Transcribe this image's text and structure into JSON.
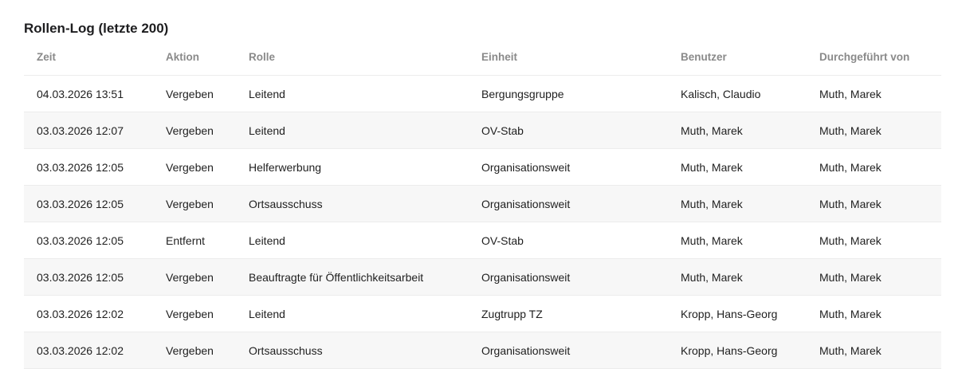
{
  "section": {
    "title": "Rollen-Log (letzte 200)"
  },
  "table": {
    "headers": [
      "Zeit",
      "Aktion",
      "Rolle",
      "Einheit",
      "Benutzer",
      "Durchgeführt von"
    ],
    "rows": [
      [
        "04.03.2026 13:51",
        "Vergeben",
        "Leitend",
        "Bergungsgruppe",
        "Kalisch, Claudio",
        "Muth, Marek"
      ],
      [
        "03.03.2026 12:07",
        "Vergeben",
        "Leitend",
        "OV-Stab",
        "Muth, Marek",
        "Muth, Marek"
      ],
      [
        "03.03.2026 12:05",
        "Vergeben",
        "Helferwerbung",
        "Organisationsweit",
        "Muth, Marek",
        "Muth, Marek"
      ],
      [
        "03.03.2026 12:05",
        "Vergeben",
        "Ortsausschuss",
        "Organisationsweit",
        "Muth, Marek",
        "Muth, Marek"
      ],
      [
        "03.03.2026 12:05",
        "Entfernt",
        "Leitend",
        "OV-Stab",
        "Muth, Marek",
        "Muth, Marek"
      ],
      [
        "03.03.2026 12:05",
        "Vergeben",
        "Beauftragte für Öffentlichkeitsarbeit",
        "Organisationsweit",
        "Muth, Marek",
        "Muth, Marek"
      ],
      [
        "03.03.2026 12:02",
        "Vergeben",
        "Leitend",
        "Zugtrupp TZ",
        "Kropp, Hans-Georg",
        "Muth, Marek"
      ],
      [
        "03.03.2026 12:02",
        "Vergeben",
        "Ortsausschuss",
        "Organisationsweit",
        "Kropp, Hans-Georg",
        "Muth, Marek"
      ]
    ]
  }
}
